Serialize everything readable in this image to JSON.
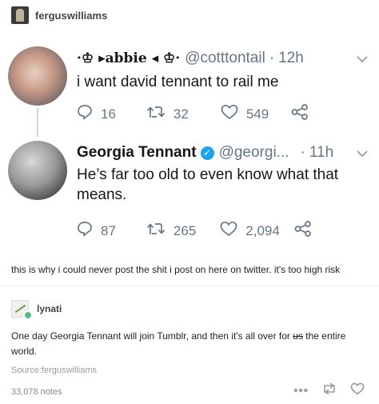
{
  "post": {
    "username": "ferguswilliams"
  },
  "tweet1": {
    "display_name": "·♔ ▸abbie ◂ ♔·",
    "handle": "@cotttontail",
    "dot": "·",
    "time": "12h",
    "text": "i want david tennant to rail me",
    "replies": "16",
    "retweets": "32",
    "likes": "549"
  },
  "tweet2": {
    "display_name": "Georgia Tennant",
    "handle": "@georgi...",
    "dot": "·",
    "time": "11h",
    "text": "He’s far too old to even know what that means.",
    "replies": "87",
    "retweets": "265",
    "likes": "2,094"
  },
  "caption": "this is why i could never post the shit i post on here on twitter. it's too high risk",
  "reblog": {
    "username": "lynati",
    "text_before": "One day Georgia Tennant will join Tumblr, and then it's all over for ",
    "text_strike": "us",
    "text_after": " the entire world.",
    "source": "Source:ferguswilliams"
  },
  "footer": {
    "notes": "33,078 notes"
  },
  "icons": {
    "reply": "reply-icon",
    "retweet": "retweet-icon",
    "like": "heart-icon",
    "share": "share-icon",
    "verified": "verified-badge-icon",
    "caret": "chevron-down-icon"
  },
  "colors": {
    "twitter_gray": "#657786",
    "verified_blue": "#1da1f2",
    "reblog_badge": "#56bc8a"
  }
}
